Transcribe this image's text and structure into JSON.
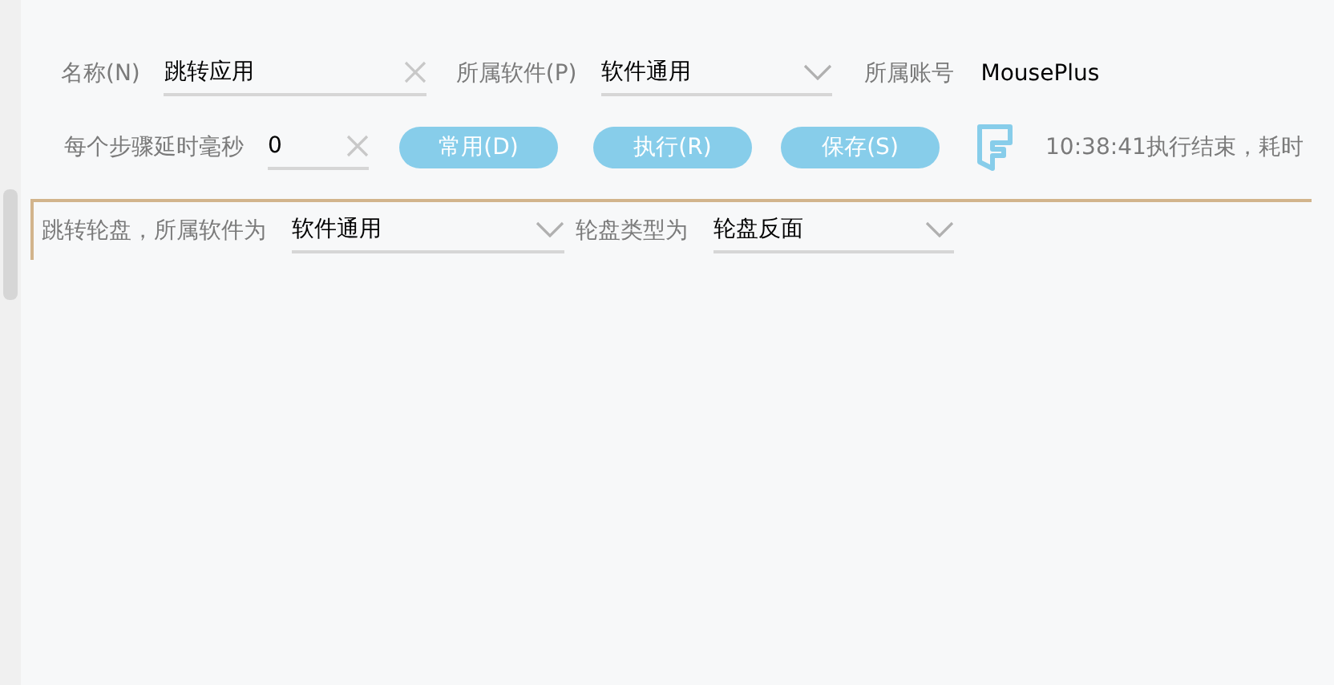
{
  "row1": [
    {
      "kind": "text",
      "label": "名称(N)",
      "value": "跳转应用"
    },
    {
      "kind": "select",
      "label": "所属软件(P)",
      "value": "软件通用"
    },
    {
      "kind": "static",
      "label": "所属账号",
      "value": "MousePlus"
    }
  ],
  "delay": {
    "label": "每个步骤延时毫秒",
    "value": "0"
  },
  "buttons": [
    "常用(D)",
    "执行(R)",
    "保存(S)"
  ],
  "status": "10:38:41执行结束，耗时",
  "step": {
    "fields": [
      {
        "label": "跳转轮盘，所属软件为",
        "value": "软件通用"
      },
      {
        "label": "轮盘类型为",
        "value": "轮盘反面"
      }
    ]
  }
}
